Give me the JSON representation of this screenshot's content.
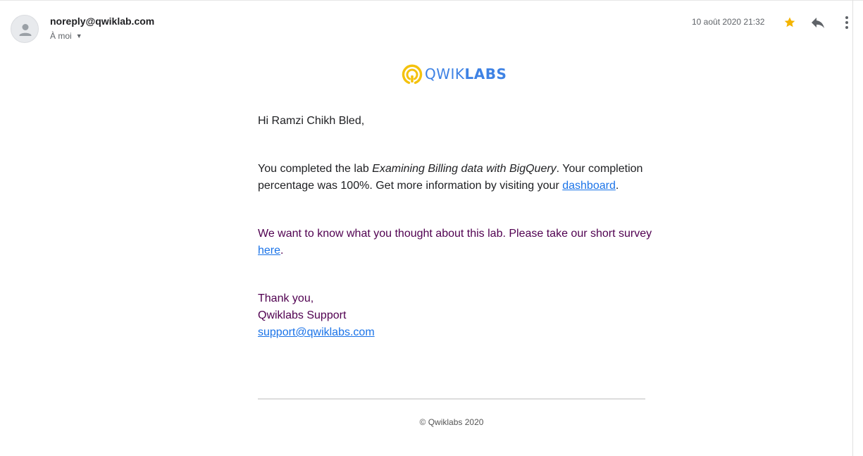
{
  "header": {
    "sender": "noreply@qwiklab.com",
    "recipient": "À moi",
    "date": "10 août 2020 21:32",
    "icons": [
      "avatar-icon",
      "star-icon",
      "reply-icon",
      "more-vert-icon"
    ],
    "star_color": "#F4B400"
  },
  "logo": {
    "text_light": "QWIK",
    "text_bold": "LABS",
    "brand_blue": "#3E82E4",
    "brand_yellow": "#F4C20D"
  },
  "message": {
    "greeting": "Hi Ramzi Chikh Bled,",
    "para1_prefix": "You completed the lab ",
    "lab_name": "Examining Billing data with BigQuery",
    "para1_middle": ". Your completion percentage was 100%. Get more information by visiting your ",
    "dashboard_link": "dashboard",
    "para1_suffix": ".",
    "para2_prefix": "We want to know what you thought about this lab. Please take our short survey ",
    "survey_link": "here",
    "para2_suffix": ".",
    "thanks": "Thank you,",
    "signature": "Qwiklabs Support",
    "support_email": "support@qwiklabs.com"
  },
  "footer": {
    "copyright": "© Qwiklabs 2020"
  }
}
